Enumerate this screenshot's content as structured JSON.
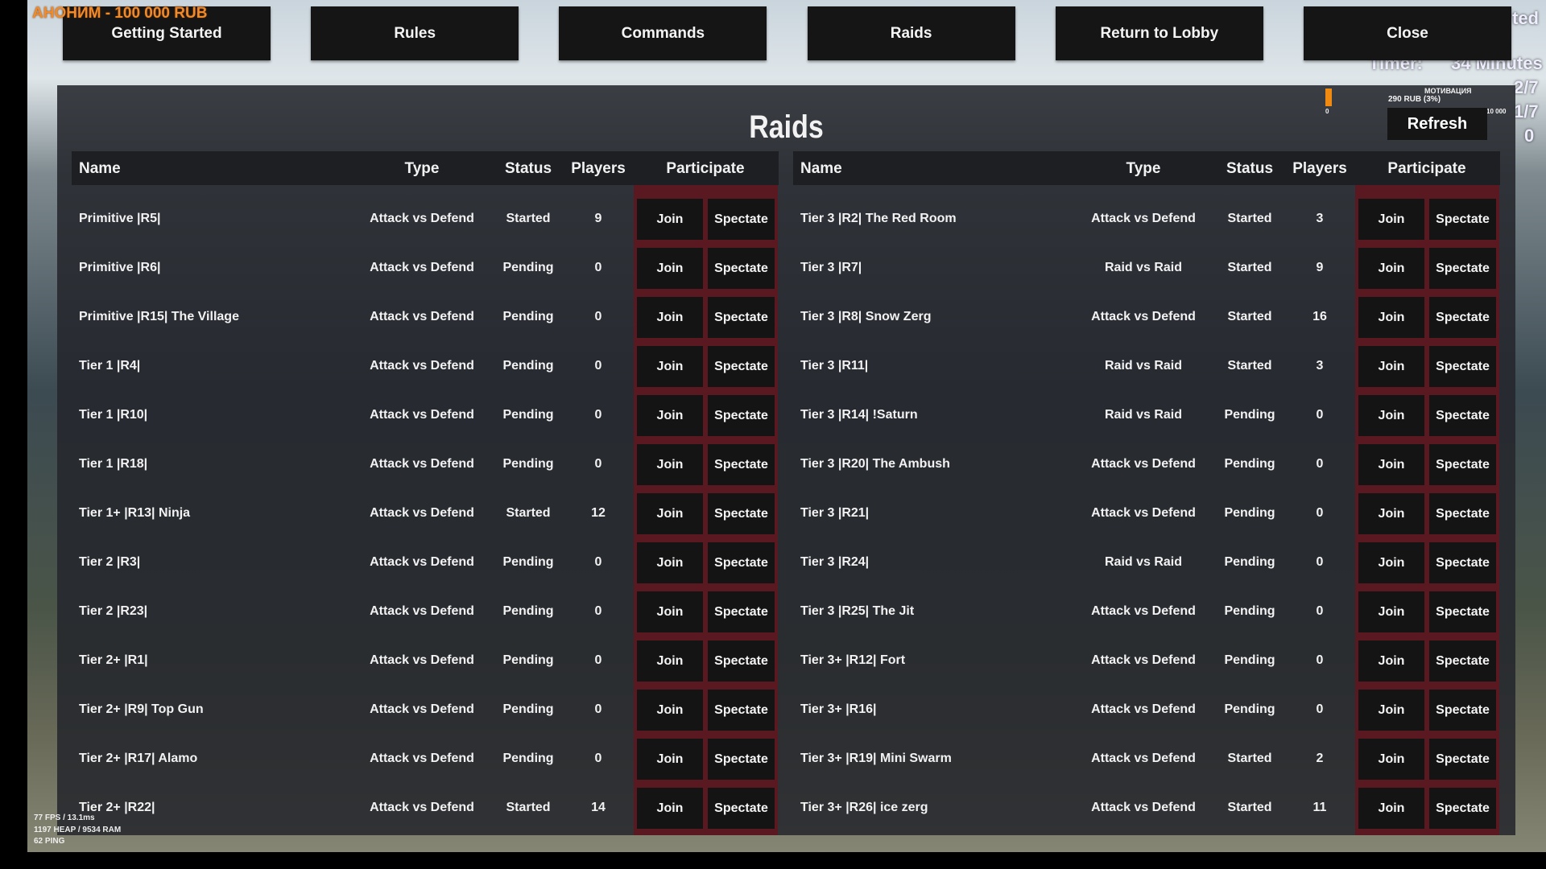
{
  "donation": "АНОНИМ - 100 000 RUB",
  "nav": [
    "Getting Started",
    "Rules",
    "Commands",
    "Raids",
    "Return to Lobby",
    "Close"
  ],
  "hud": {
    "timer_label": "Timer:",
    "timer_value": "34 Minutes",
    "attackers": "2/7",
    "defenders": "1/7",
    "queue": "0",
    "corner": "ted"
  },
  "donation_goal": {
    "label": "МОТИВАЦИЯ",
    "current": "290 RUB (3%)",
    "min": "0",
    "max": "10 000",
    "progress_percent": 3,
    "color": "#f08a10"
  },
  "title": "Raids",
  "refresh": "Refresh",
  "columns": [
    "Name",
    "Type",
    "Status",
    "Players",
    "Participate"
  ],
  "buttons": {
    "join": "Join",
    "spectate": "Spectate"
  },
  "left_rows": [
    [
      "Primitive |R5|",
      "Attack vs Defend",
      "Started",
      "9"
    ],
    [
      "Primitive |R6|",
      "Attack vs Defend",
      "Pending",
      "0"
    ],
    [
      "Primitive |R15| The Village",
      "Attack vs Defend",
      "Pending",
      "0"
    ],
    [
      "Tier 1 |R4|",
      "Attack vs Defend",
      "Pending",
      "0"
    ],
    [
      "Tier 1 |R10|",
      "Attack vs Defend",
      "Pending",
      "0"
    ],
    [
      "Tier 1 |R18|",
      "Attack vs Defend",
      "Pending",
      "0"
    ],
    [
      "Tier 1+ |R13| Ninja",
      "Attack vs Defend",
      "Started",
      "12"
    ],
    [
      "Tier 2 |R3|",
      "Attack vs Defend",
      "Pending",
      "0"
    ],
    [
      "Tier 2 |R23|",
      "Attack vs Defend",
      "Pending",
      "0"
    ],
    [
      "Tier 2+ |R1|",
      "Attack vs Defend",
      "Pending",
      "0"
    ],
    [
      "Tier 2+ |R9| Top Gun",
      "Attack vs Defend",
      "Pending",
      "0"
    ],
    [
      "Tier 2+ |R17| Alamo",
      "Attack vs Defend",
      "Pending",
      "0"
    ],
    [
      "Tier 2+ |R22|",
      "Attack vs Defend",
      "Started",
      "14"
    ]
  ],
  "right_rows": [
    [
      "Tier 3 |R2| The Red Room",
      "Attack vs Defend",
      "Started",
      "3"
    ],
    [
      "Tier 3 |R7|",
      "Raid vs Raid",
      "Started",
      "9"
    ],
    [
      "Tier 3 |R8| Snow Zerg",
      "Attack vs Defend",
      "Started",
      "16"
    ],
    [
      "Tier 3 |R11|",
      "Raid vs Raid",
      "Started",
      "3"
    ],
    [
      "Tier 3 |R14| !Saturn",
      "Raid vs Raid",
      "Pending",
      "0"
    ],
    [
      "Tier 3 |R20| The Ambush",
      "Attack vs Defend",
      "Pending",
      "0"
    ],
    [
      "Tier 3 |R21|",
      "Attack vs Defend",
      "Pending",
      "0"
    ],
    [
      "Tier 3 |R24|",
      "Raid vs Raid",
      "Pending",
      "0"
    ],
    [
      "Tier 3 |R25| The Jit",
      "Attack vs Defend",
      "Pending",
      "0"
    ],
    [
      "Tier 3+ |R12| Fort",
      "Attack vs Defend",
      "Pending",
      "0"
    ],
    [
      "Tier 3+ |R16|",
      "Attack vs Defend",
      "Pending",
      "0"
    ],
    [
      "Tier 3+ |R19| Mini Swarm",
      "Attack vs Defend",
      "Started",
      "2"
    ],
    [
      "Tier 3+ |R26| ice zerg",
      "Attack vs Defend",
      "Started",
      "11"
    ]
  ],
  "perf": [
    "77 FPS / 13.1ms",
    "1197 HEAP / 9534 RAM",
    "62 PING"
  ]
}
